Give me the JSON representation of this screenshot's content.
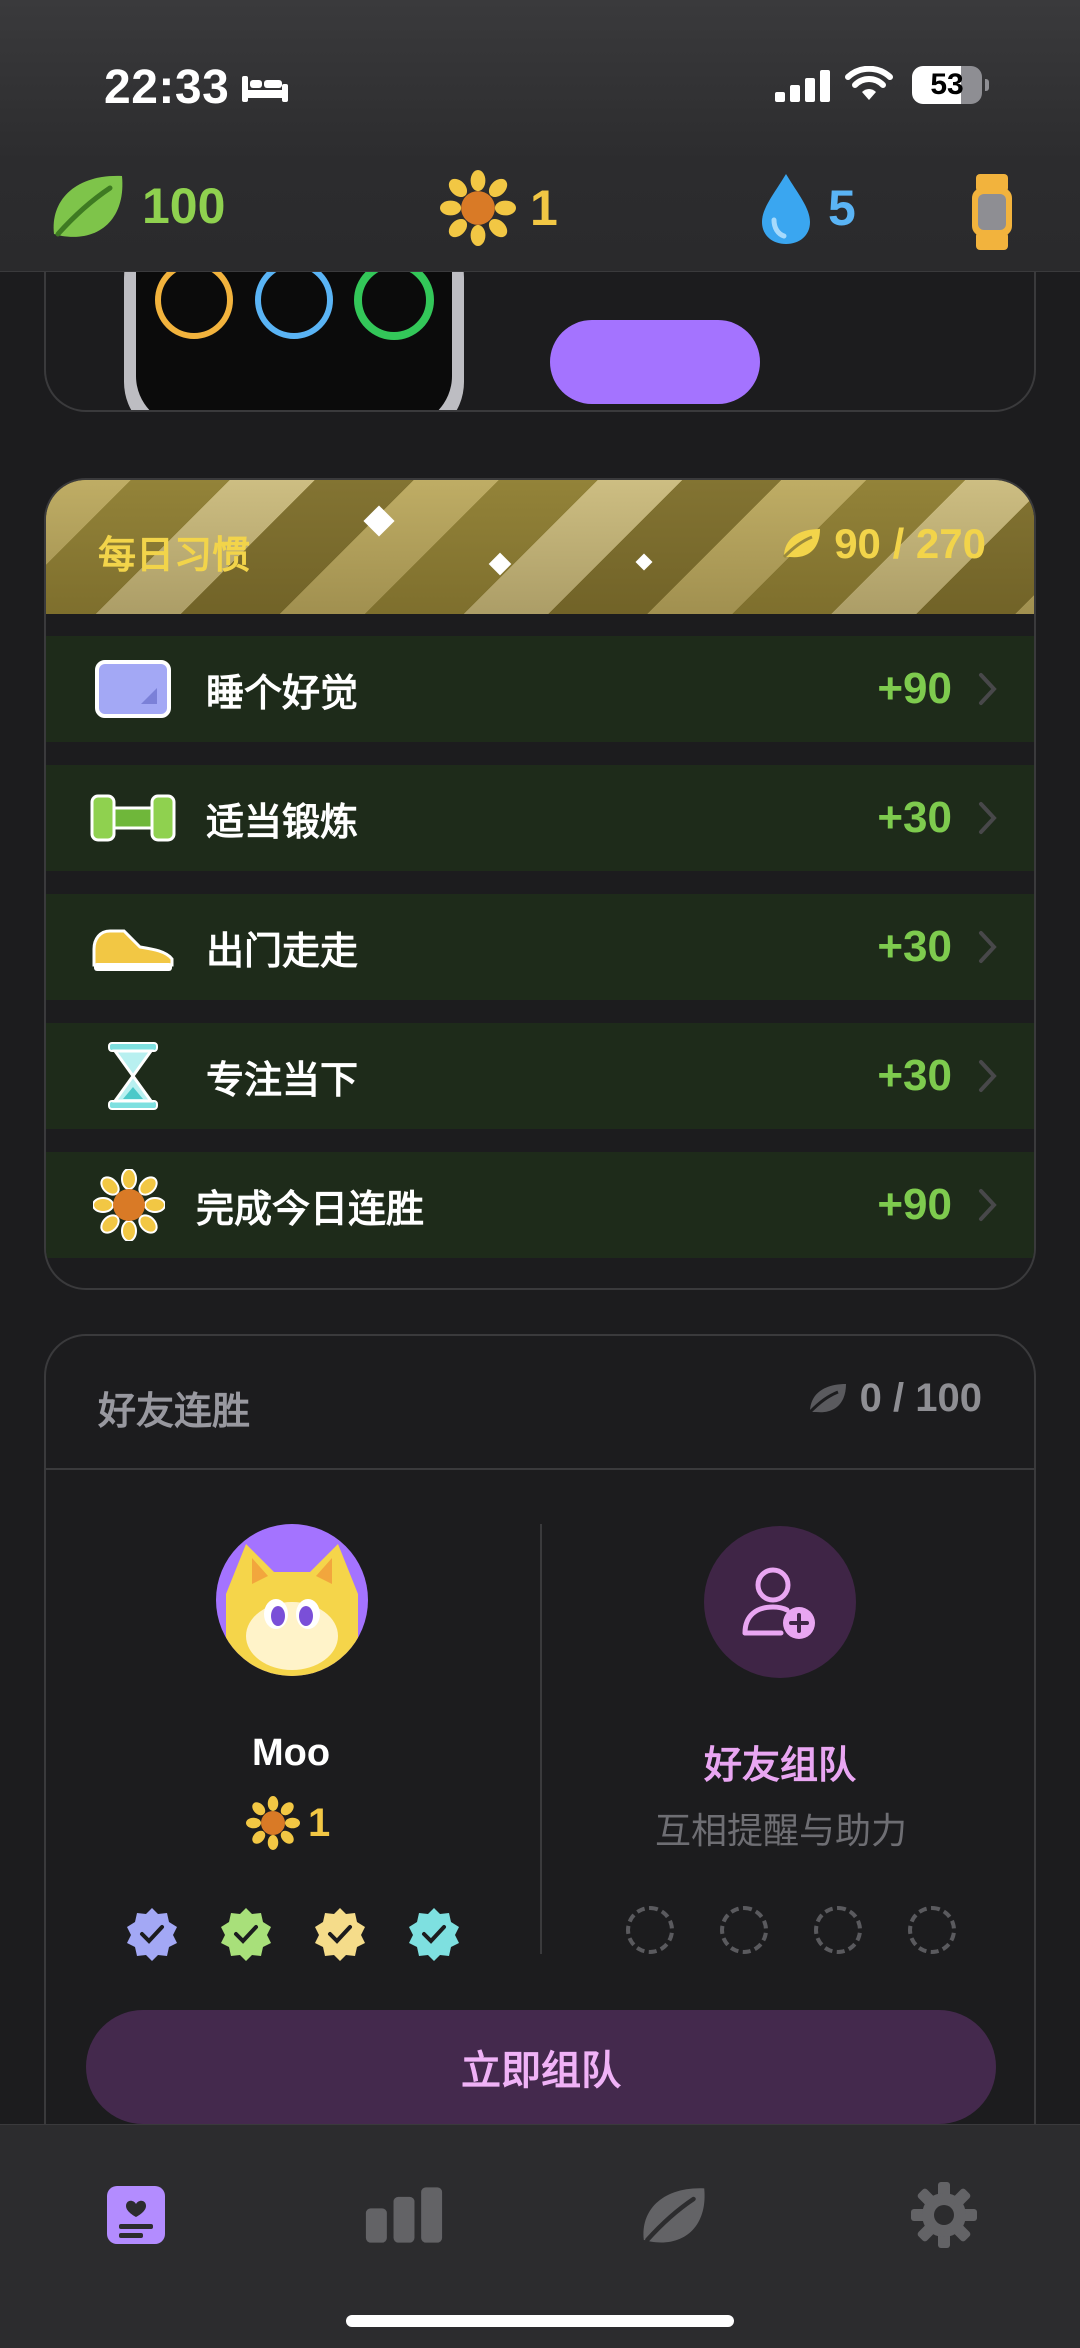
{
  "status_bar": {
    "time": "22:33",
    "battery": "53"
  },
  "header_stats": {
    "leaves": "100",
    "suns": "1",
    "drops": "5",
    "colors": {
      "leaves": "#8fd14f",
      "suns": "#f2c744",
      "drops": "#5ab4f5"
    }
  },
  "daily_habits": {
    "title": "每日习惯",
    "progress": "90 / 270",
    "items": [
      {
        "label": "睡个好觉",
        "points": "+90",
        "icon": "pillow-icon"
      },
      {
        "label": "适当锻炼",
        "points": "+30",
        "icon": "dumbbell-icon"
      },
      {
        "label": "出门走走",
        "points": "+30",
        "icon": "sneaker-icon"
      },
      {
        "label": "专注当下",
        "points": "+30",
        "icon": "hourglass-icon"
      },
      {
        "label": "完成今日连胜",
        "points": "+90",
        "icon": "sunflower-icon"
      }
    ]
  },
  "friend_streak": {
    "title": "好友连胜",
    "progress": "0 / 100",
    "friend": {
      "name": "Moo",
      "streak": "1"
    },
    "invite": {
      "title": "好友组队",
      "subtitle": "互相提醒与助力"
    },
    "team_button": "立即组队"
  },
  "tab_bar": {
    "tabs": [
      "journal-icon",
      "stats-icon",
      "leaf-icon",
      "settings-icon"
    ]
  }
}
